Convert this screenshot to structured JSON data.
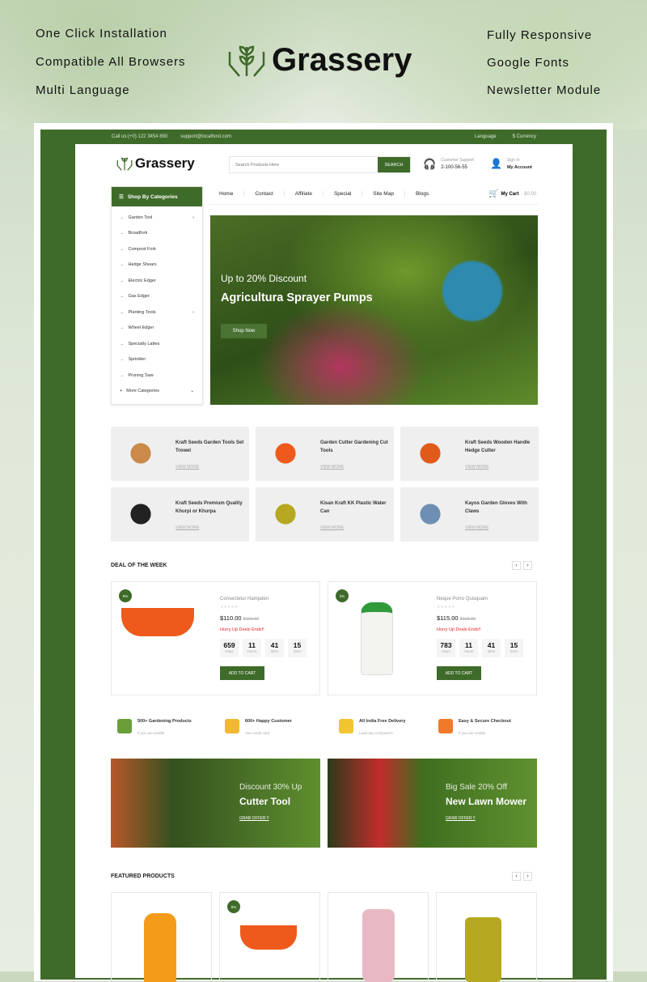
{
  "hero": {
    "features_left": [
      "One Click Installation",
      "Compatible All Browsers",
      "Multi Language"
    ],
    "features_right": [
      "Fully Responsive",
      "Google Fonts",
      "Newsletter Module"
    ],
    "brand": "Grassery"
  },
  "topbar": {
    "phone": "Call us:(+0) 122 3454 890",
    "email": "support@localhost.com",
    "language": "Language",
    "currency": "$ Currency"
  },
  "header": {
    "logo": "Grassery",
    "search_placeholder": "Search Products Here",
    "search_button": "SEARCH",
    "support_label": "Customer Support",
    "support_phone": "2-100-56-55",
    "signin_label": "Sign In",
    "account_label": "My Account",
    "cart_label": "My Cart",
    "cart_total": "- $0.00",
    "cart_count": "0"
  },
  "categories": {
    "title": "Shop By Categories",
    "items": [
      {
        "label": "Garden Tool",
        "sub": true
      },
      {
        "label": "Broadfork"
      },
      {
        "label": "Compost Fork"
      },
      {
        "label": "Hedge Shears"
      },
      {
        "label": "Electric Edger"
      },
      {
        "label": "Gas Edger"
      },
      {
        "label": "Planting Tools",
        "sub": true
      },
      {
        "label": "Wheel Edger"
      },
      {
        "label": "Specialty Lattes"
      },
      {
        "label": "Sprinkler"
      },
      {
        "label": "Pruning Saw"
      }
    ],
    "more": "More Categories"
  },
  "nav": [
    "Home",
    "Contact",
    "Affiliate",
    "Special",
    "Site Map",
    "Blogs"
  ],
  "banner": {
    "subtitle": "Up to 20% Discount",
    "title": "Agricultura Sprayer Pumps",
    "button": "Shop Now"
  },
  "tiles": [
    {
      "title": "Kraft Seeds Garden Tools Set Trowel",
      "link": "VIEW MORE"
    },
    {
      "title": "Garden Cutter Gardening Cut Tools",
      "link": "VIEW MORE"
    },
    {
      "title": "Kraft Seeds Wooden Handle Hedge Cutter",
      "link": "VIEW MORE"
    },
    {
      "title": "Kraft Seeds Premium Quality Khurpi or Khurpa",
      "link": "VIEW MORE"
    },
    {
      "title": "Kisan Kraft KK Plastic Water Can",
      "link": "VIEW MORE"
    },
    {
      "title": "Kayos Garden Gloves With Claws",
      "link": "VIEW MORE"
    }
  ],
  "deal": {
    "title": "DEAL OF THE WEEK",
    "items": [
      {
        "badge": "8%",
        "name": "Consectetur Hampden",
        "price": "$110.00",
        "old_price": "$119.60",
        "hurry": "Hurry Up Deals Ends!!",
        "countdown": [
          {
            "v": "659",
            "l": "Days"
          },
          {
            "v": "11",
            "l": "Hours"
          },
          {
            "v": "41",
            "l": "Mins"
          },
          {
            "v": "15",
            "l": "Secs"
          }
        ],
        "button": "ADD TO CART",
        "rating": 0
      },
      {
        "badge": "3%",
        "name": "Neque Porro Quisquam",
        "price": "$115.00",
        "old_price": "$118.00",
        "hurry": "Hurry Up Deals Ends!!",
        "countdown": [
          {
            "v": "783",
            "l": "Days"
          },
          {
            "v": "11",
            "l": "Hours"
          },
          {
            "v": "41",
            "l": "Mins"
          },
          {
            "v": "15",
            "l": "Secs"
          }
        ],
        "button": "ADD TO CART",
        "rating": 0
      }
    ]
  },
  "services": [
    {
      "title": "500+ Gardening Products",
      "sub": "If you are unable"
    },
    {
      "title": "600+ Happy Customer",
      "sub": "Use credit card"
    },
    {
      "title": "All India Free Delivery",
      "sub": "Load any computer's"
    },
    {
      "title": "Easy & Secure Checkout",
      "sub": "If you are unable"
    }
  ],
  "promos": [
    {
      "sub": "Discount 30% Up",
      "title": "Cutter Tool",
      "link": "GRAB OFFER !!"
    },
    {
      "sub": "Big Sale 20% Off",
      "title": "New Lawn Mower",
      "link": "GRAB OFFER !!"
    }
  ],
  "featured": {
    "title": "FEATURED PRODUCTS",
    "badge": "8%"
  },
  "colors": {
    "primary": "#3f6b2a",
    "hurry": "#e8242c"
  }
}
